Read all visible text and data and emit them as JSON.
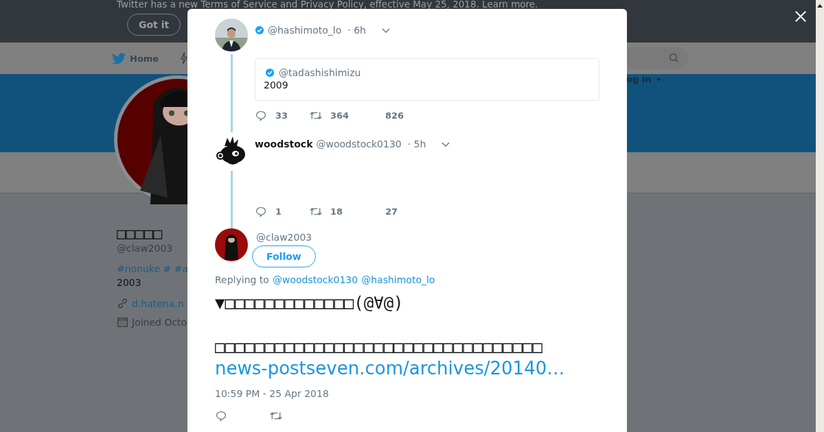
{
  "banner": {
    "text": "Twitter has a new Terms of Service and Privacy Policy, effective May 25, 2018. Learn more.",
    "button": "Got it"
  },
  "nav": {
    "home": "Home",
    "login": "og in"
  },
  "profile": {
    "name": "□□□□□",
    "handle": "@claw2003",
    "tags": "#nonuke # #a",
    "bio": "2003",
    "link": "d.hatena.n",
    "joined": "Joined Octo"
  },
  "thread": [
    {
      "handle": "@hashimoto_lo",
      "verified": true,
      "time": "· 6h",
      "quote": {
        "handle": "@tadashishimizu",
        "verified": true,
        "text": "2009"
      },
      "replies": "33",
      "retweets": "364",
      "likes": "826"
    },
    {
      "name": "woodstock",
      "handle": "@woodstock0130",
      "verified": false,
      "time": "· 5h",
      "replies": "1",
      "retweets": "18",
      "likes": "27"
    }
  ],
  "main": {
    "handle": "@claw2003",
    "follow": "Follow",
    "replying_label": "Replying to",
    "mentions": [
      "@woodstock0130",
      "@hashimoto_lo"
    ],
    "lines": [
      "▼□□□□□□□□□□□□□(@∀@)",
      "□□□□□□□□□□□□□□□□□□□□□□□□□□□□□□□□□"
    ],
    "link": "news-postseven.com/archives/20140…",
    "timestamp": "10:59 PM - 25 Apr 2018"
  }
}
